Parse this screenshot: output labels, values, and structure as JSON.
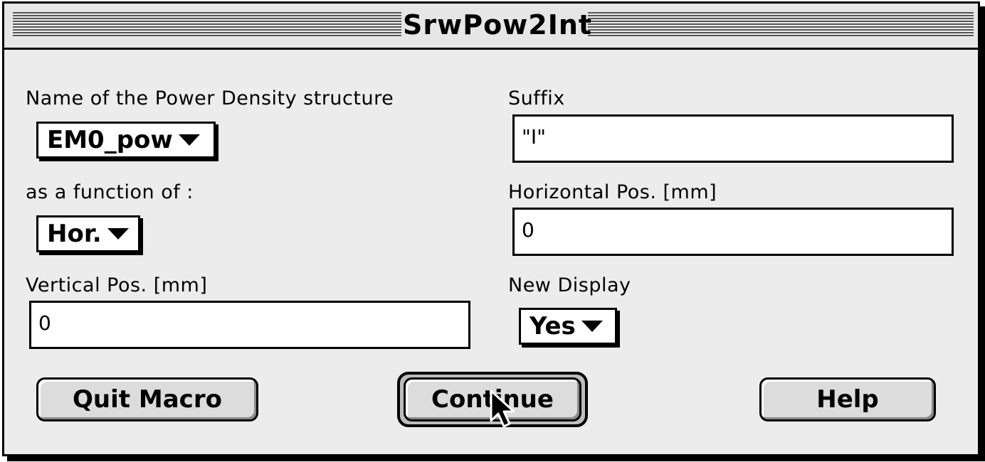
{
  "window": {
    "title": "SrwPow2Int"
  },
  "fields": {
    "power_density_label": "Name of the Power Density structure",
    "power_density_value": "EM0_pow",
    "function_of_label": "as a function of :",
    "function_of_value": "Hor.",
    "vertical_pos_label": "Vertical Pos. [mm]",
    "vertical_pos_value": "0",
    "suffix_label": "Suffix",
    "suffix_value": "\"I\"",
    "horizontal_pos_label": "Horizontal Pos. [mm]",
    "horizontal_pos_value": "0",
    "new_display_label": "New Display",
    "new_display_value": "Yes"
  },
  "buttons": {
    "quit": "Quit Macro",
    "continue": "Continue",
    "help": "Help"
  },
  "icons": {
    "dropdown": "triangle-down-icon",
    "cursor": "arrow-cursor-icon"
  }
}
